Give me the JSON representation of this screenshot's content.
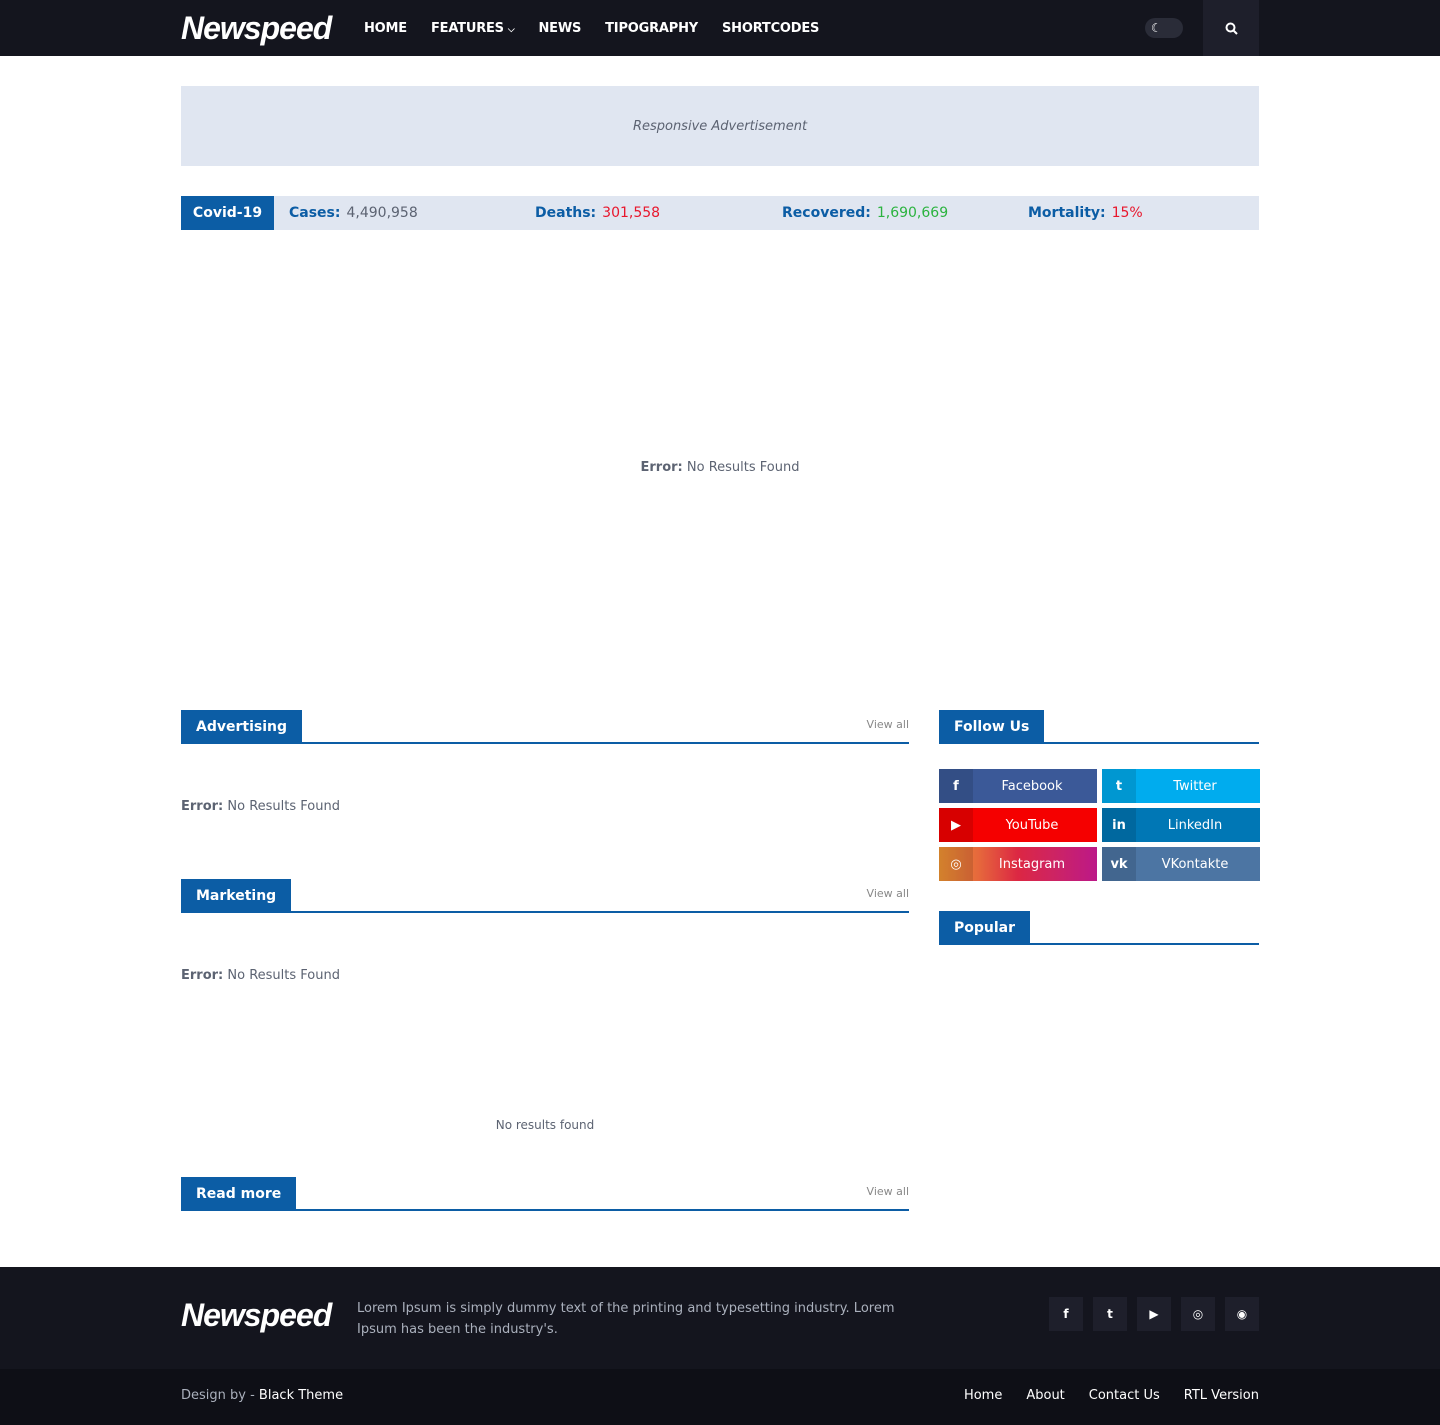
{
  "header": {
    "logo": "Newspeed",
    "nav": [
      "HOME",
      "FEATURES",
      "NEWS",
      "TIPOGRAPHY",
      "SHORTCODES"
    ],
    "features_caret": "⌄"
  },
  "ad": {
    "label": "Responsive Advertisement"
  },
  "covid": {
    "tag": "Covid-19",
    "cases_label": "Cases:",
    "cases": "4,490,958",
    "deaths_label": "Deaths:",
    "deaths": "301,558",
    "recovered_label": "Recovered:",
    "recovered": "1,690,669",
    "mortality_label": "Mortality:",
    "mortality": "15%",
    "colors": {
      "cases": "#5c6372",
      "deaths": "#e8162c",
      "recovered": "#2bb33f",
      "mortality": "#e8162c"
    }
  },
  "main_error": {
    "label": "Error:",
    "text": "No Results Found"
  },
  "sections": {
    "advertising": {
      "title": "Advertising",
      "view_all": "View all",
      "error_label": "Error:",
      "error_text": "No Results Found"
    },
    "marketing": {
      "title": "Marketing",
      "view_all": "View all",
      "error_label": "Error:",
      "error_text": "No Results Found"
    },
    "no_results": "No results found",
    "read_more": {
      "title": "Read more",
      "view_all": "View all"
    }
  },
  "sidebar": {
    "follow_title": "Follow Us",
    "social": [
      {
        "label": "Facebook",
        "icon": "facebook-icon",
        "glyph": "f",
        "color": "#3b5998"
      },
      {
        "label": "Twitter",
        "icon": "twitter-icon",
        "glyph": "t",
        "color": "#00acee"
      },
      {
        "label": "YouTube",
        "icon": "youtube-icon",
        "glyph": "▶",
        "color": "#f50000"
      },
      {
        "label": "LinkedIn",
        "icon": "linkedin-icon",
        "glyph": "in",
        "color": "#0077b5"
      },
      {
        "label": "Instagram",
        "icon": "instagram-icon",
        "glyph": "◎",
        "color": "#d12e7c"
      },
      {
        "label": "VKontakte",
        "icon": "vk-icon",
        "glyph": "vk",
        "color": "#4c75a3"
      }
    ],
    "popular_title": "Popular"
  },
  "footer": {
    "logo": "Newspeed",
    "text": "Lorem Ipsum is simply dummy text of the printing and typesetting industry. Lorem Ipsum has been the industry's.",
    "icons": [
      "facebook-icon",
      "twitter-icon",
      "youtube-icon",
      "instagram-icon",
      "rss-icon"
    ],
    "icon_glyphs": [
      "f",
      "t",
      "▶",
      "◎",
      "◉"
    ],
    "credit_prefix": "Design by - ",
    "credit_name": "Black Theme",
    "links": [
      "Home",
      "About",
      "Contact Us",
      "RTL Version"
    ]
  },
  "brand_color": "#0c5da5"
}
